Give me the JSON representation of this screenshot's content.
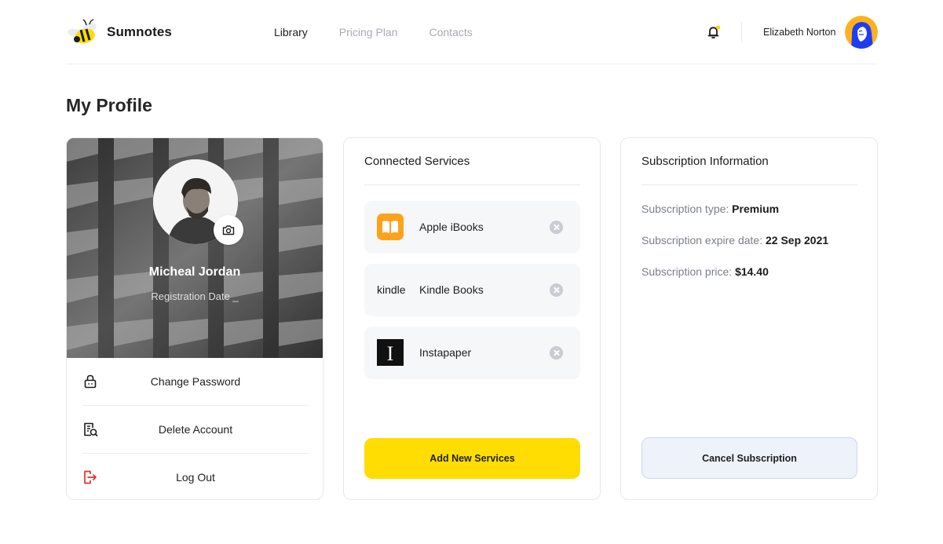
{
  "app": {
    "brand": "Sumnotes"
  },
  "nav": {
    "items": [
      {
        "label": "Library",
        "active": true
      },
      {
        "label": "Pricing Plan",
        "active": false
      },
      {
        "label": "Contacts",
        "active": false
      }
    ]
  },
  "user": {
    "name": "Elizabeth Norton"
  },
  "colors": {
    "accent": "#ffdd00",
    "notify": "#ffd400",
    "avatar_bg": "#ffb21f",
    "avatar_fg": "#1d3df5",
    "logout_icon": "#e0322d"
  },
  "page": {
    "title": "My Profile"
  },
  "profile": {
    "name": "Micheal Jordan",
    "registration": "Registration Date _",
    "menu": [
      {
        "label": "Change Password",
        "icon": "lock-icon"
      },
      {
        "label": "Delete Account",
        "icon": "delete-account-icon"
      },
      {
        "label": "Log Out",
        "icon": "logout-icon"
      }
    ]
  },
  "services": {
    "title": "Connected Services",
    "items": [
      {
        "label": "Apple iBooks",
        "icon": "apple-ibooks-icon"
      },
      {
        "label": "Kindle Books",
        "icon": "kindle-logo",
        "logo_text": "kindle"
      },
      {
        "label": "Instapaper",
        "icon": "instapaper-icon",
        "logo_text": "I"
      }
    ],
    "add_label": "Add New Services"
  },
  "subscription": {
    "title": "Subscription Information",
    "type_label": "Subscription type:",
    "type_value": "Premium",
    "expire_label": "Subscription expire date:",
    "expire_value": "22 Sep 2021",
    "price_label": "Subscription price:",
    "price_value": "$14.40",
    "cancel_label": "Cancel Subscription"
  }
}
